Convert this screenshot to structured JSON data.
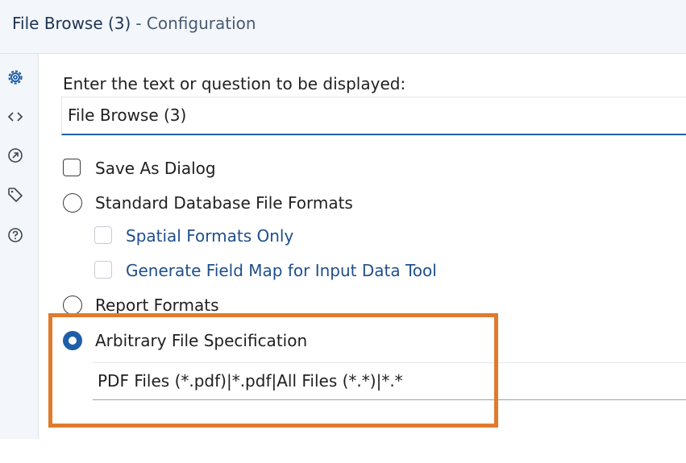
{
  "header": {
    "title": "File Browse (3)",
    "subtitle": "- Configuration"
  },
  "sidebar": {
    "icons": [
      "gear-icon",
      "code-icon",
      "arrow-circle-icon",
      "tag-icon",
      "help-icon"
    ]
  },
  "form": {
    "prompt_label": "Enter the text or question to be displayed:",
    "prompt_value": "File Browse (3)",
    "save_as_dialog": {
      "label": "Save As Dialog",
      "checked": false
    },
    "standard_db": {
      "label": "Standard Database File Formats",
      "selected": false
    },
    "spatial_only": {
      "label": "Spatial Formats Only",
      "checked": false,
      "enabled": false
    },
    "field_map": {
      "label": "Generate Field Map for Input Data Tool",
      "checked": false,
      "enabled": false
    },
    "report_formats": {
      "label": "Report Formats",
      "selected": false
    },
    "arbitrary": {
      "label": "Arbitrary File Specification",
      "selected": true
    },
    "file_spec_value": "PDF Files (*.pdf)|*.pdf|All Files (*.*)|*.*"
  },
  "colors": {
    "accent": "#1f5ea8",
    "highlight": "#e07b2e",
    "disabled_text": "#1f4f8a"
  }
}
